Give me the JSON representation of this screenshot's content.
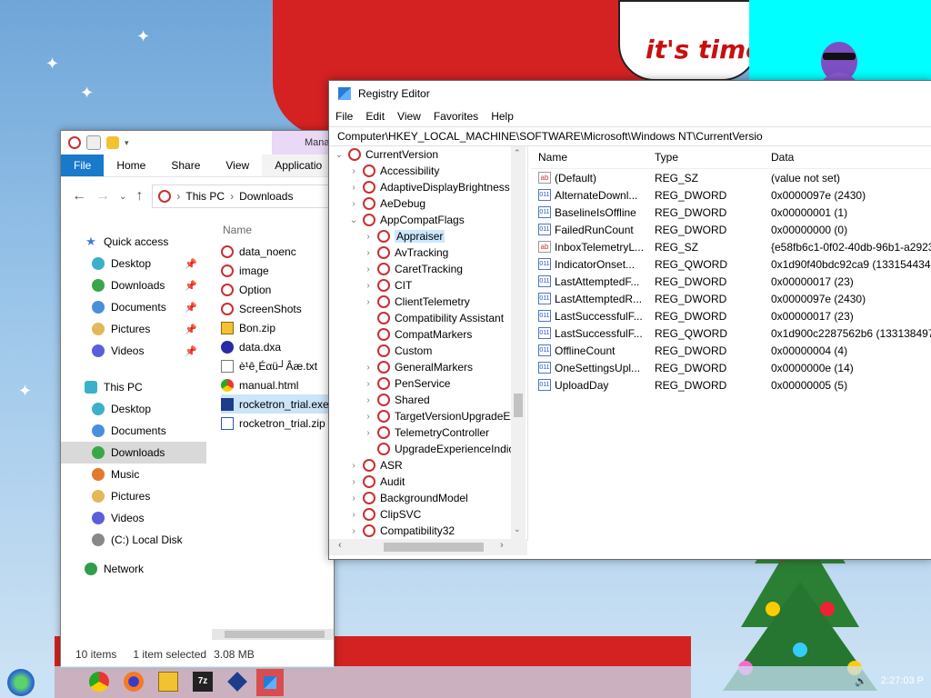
{
  "desktop": {
    "speech_text": "it's time"
  },
  "explorer": {
    "manage_tab": "Mana",
    "ribbon": [
      "File",
      "Home",
      "Share",
      "View",
      "Applicatio"
    ],
    "breadcrumb": [
      "This PC",
      "Downloads"
    ],
    "sidebar": [
      {
        "label": "Quick access",
        "icon": "star-icon",
        "pinned": false
      },
      {
        "label": "Desktop",
        "icon": "desktop-icon",
        "pinned": true
      },
      {
        "label": "Downloads",
        "icon": "downloads-icon",
        "pinned": true
      },
      {
        "label": "Documents",
        "icon": "documents-icon",
        "pinned": true
      },
      {
        "label": "Pictures",
        "icon": "pictures-icon",
        "pinned": true
      },
      {
        "label": "Videos",
        "icon": "videos-icon",
        "pinned": true
      },
      {
        "label": "This PC",
        "icon": "this-pc-icon",
        "pinned": false
      },
      {
        "label": "Desktop",
        "icon": "desktop-icon",
        "pinned": false
      },
      {
        "label": "Documents",
        "icon": "documents-icon",
        "pinned": false
      },
      {
        "label": "Downloads",
        "icon": "downloads-icon",
        "pinned": false,
        "selected": true
      },
      {
        "label": "Music",
        "icon": "music-icon",
        "pinned": false
      },
      {
        "label": "Pictures",
        "icon": "pictures-icon",
        "pinned": false
      },
      {
        "label": "Videos",
        "icon": "videos-icon",
        "pinned": false
      },
      {
        "label": "(C:) Local Disk",
        "icon": "disk-icon",
        "pinned": false
      },
      {
        "label": "Network",
        "icon": "network-icon",
        "pinned": false
      }
    ],
    "column_name": "Name",
    "files": [
      {
        "name": "data_noenc",
        "icon": "registry-file-icon"
      },
      {
        "name": "image",
        "icon": "registry-file-icon"
      },
      {
        "name": "Option",
        "icon": "registry-file-icon"
      },
      {
        "name": "ScreenShots",
        "icon": "registry-file-icon"
      },
      {
        "name": "Bon.zip",
        "icon": "zip-icon"
      },
      {
        "name": "data.dxa",
        "icon": "dxa-icon"
      },
      {
        "name": "è¹ê¸Éαü┘Âæ.txt",
        "icon": "txt-icon"
      },
      {
        "name": "manual.html",
        "icon": "chrome-html-icon"
      },
      {
        "name": "rocketron_trial.exe",
        "icon": "exe-icon",
        "selected": true
      },
      {
        "name": "rocketron_trial.zip",
        "icon": "zip-archive-icon"
      }
    ],
    "status": {
      "items": "10 items",
      "selected": "1 item selected",
      "size": "3.08 MB"
    }
  },
  "regedit": {
    "title": "Registry Editor",
    "menu": [
      "File",
      "Edit",
      "View",
      "Favorites",
      "Help"
    ],
    "address": "Computer\\HKEY_LOCAL_MACHINE\\SOFTWARE\\Microsoft\\Windows NT\\CurrentVersio",
    "tree": [
      {
        "label": "CurrentVersion",
        "depth": 0,
        "exp": "⌄"
      },
      {
        "label": "Accessibility",
        "depth": 1,
        "exp": "›"
      },
      {
        "label": "AdaptiveDisplayBrightness",
        "depth": 1,
        "exp": "›"
      },
      {
        "label": "AeDebug",
        "depth": 1,
        "exp": "›"
      },
      {
        "label": "AppCompatFlags",
        "depth": 1,
        "exp": "⌄"
      },
      {
        "label": "Appraiser",
        "depth": 2,
        "exp": "›",
        "selected": true
      },
      {
        "label": "AvTracking",
        "depth": 2,
        "exp": "›"
      },
      {
        "label": "CaretTracking",
        "depth": 2,
        "exp": "›"
      },
      {
        "label": "CIT",
        "depth": 2,
        "exp": "›"
      },
      {
        "label": "ClientTelemetry",
        "depth": 2,
        "exp": "›"
      },
      {
        "label": "Compatibility Assistant",
        "depth": 2,
        "exp": ""
      },
      {
        "label": "CompatMarkers",
        "depth": 2,
        "exp": ""
      },
      {
        "label": "Custom",
        "depth": 2,
        "exp": ""
      },
      {
        "label": "GeneralMarkers",
        "depth": 2,
        "exp": "›"
      },
      {
        "label": "PenService",
        "depth": 2,
        "exp": "›"
      },
      {
        "label": "Shared",
        "depth": 2,
        "exp": "›"
      },
      {
        "label": "TargetVersionUpgradeExp",
        "depth": 2,
        "exp": "›"
      },
      {
        "label": "TelemetryController",
        "depth": 2,
        "exp": "›"
      },
      {
        "label": "UpgradeExperienceIndica",
        "depth": 2,
        "exp": ""
      },
      {
        "label": "ASR",
        "depth": 1,
        "exp": "›"
      },
      {
        "label": "Audit",
        "depth": 1,
        "exp": "›"
      },
      {
        "label": "BackgroundModel",
        "depth": 1,
        "exp": "›"
      },
      {
        "label": "ClipSVC",
        "depth": 1,
        "exp": "›"
      },
      {
        "label": "Compatibility32",
        "depth": 1,
        "exp": "›"
      }
    ],
    "columns": {
      "name": "Name",
      "type": "Type",
      "data": "Data"
    },
    "values": [
      {
        "name": "(Default)",
        "type": "REG_SZ",
        "data": "(value not set)",
        "kind": "ab"
      },
      {
        "name": "AlternateDownl...",
        "type": "REG_DWORD",
        "data": "0x0000097e (2430)",
        "kind": "bin"
      },
      {
        "name": "BaselineIsOffline",
        "type": "REG_DWORD",
        "data": "0x00000001 (1)",
        "kind": "bin"
      },
      {
        "name": "FailedRunCount",
        "type": "REG_DWORD",
        "data": "0x00000000 (0)",
        "kind": "bin"
      },
      {
        "name": "InboxTelemetryL...",
        "type": "REG_SZ",
        "data": "{e58fb6c1-0f02-40db-96b1-a292397c",
        "kind": "ab"
      },
      {
        "name": "IndicatorOnset...",
        "type": "REG_QWORD",
        "data": "0x1d90f40bdc92ca9 (1331544347205",
        "kind": "bin"
      },
      {
        "name": "LastAttemptedF...",
        "type": "REG_DWORD",
        "data": "0x00000017 (23)",
        "kind": "bin"
      },
      {
        "name": "LastAttemptedR...",
        "type": "REG_DWORD",
        "data": "0x0000097e (2430)",
        "kind": "bin"
      },
      {
        "name": "LastSuccessfulF...",
        "type": "REG_DWORD",
        "data": "0x00000017 (23)",
        "kind": "bin"
      },
      {
        "name": "LastSuccessfulF...",
        "type": "REG_QWORD",
        "data": "0x1d900c2287562b6 (1331384978865",
        "kind": "bin"
      },
      {
        "name": "OfflineCount",
        "type": "REG_DWORD",
        "data": "0x00000004 (4)",
        "kind": "bin"
      },
      {
        "name": "OneSettingsUpl...",
        "type": "REG_DWORD",
        "data": "0x0000000e (14)",
        "kind": "bin"
      },
      {
        "name": "UploadDay",
        "type": "REG_DWORD",
        "data": "0x00000005 (5)",
        "kind": "bin"
      }
    ]
  },
  "taskbar": {
    "apps": [
      "start-button",
      "chrome-icon",
      "firefox-icon",
      "file-explorer-icon",
      "7zip-icon",
      "rocketron-icon",
      "registry-editor-icon"
    ],
    "clock": "2:27:03 P"
  }
}
